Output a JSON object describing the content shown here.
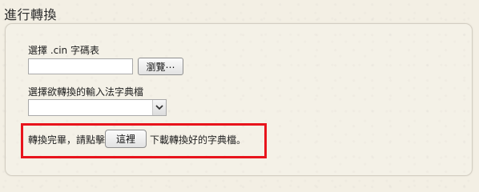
{
  "page_title": "進行轉換",
  "cin_section": {
    "label": "選擇 .cin 字碼表",
    "file_value": "",
    "browse_label": "瀏覽⋯"
  },
  "ime_section": {
    "label": "選擇欲轉換的輸入法字典檔",
    "selected_value": ""
  },
  "result": {
    "prefix_text": "轉換完畢，請點擊",
    "button_label": "這裡",
    "suffix_text": "下載轉換好的字典檔。",
    "highlight_color": "#e8141c"
  },
  "icons": {
    "dropdown": "chevron-down-icon"
  }
}
